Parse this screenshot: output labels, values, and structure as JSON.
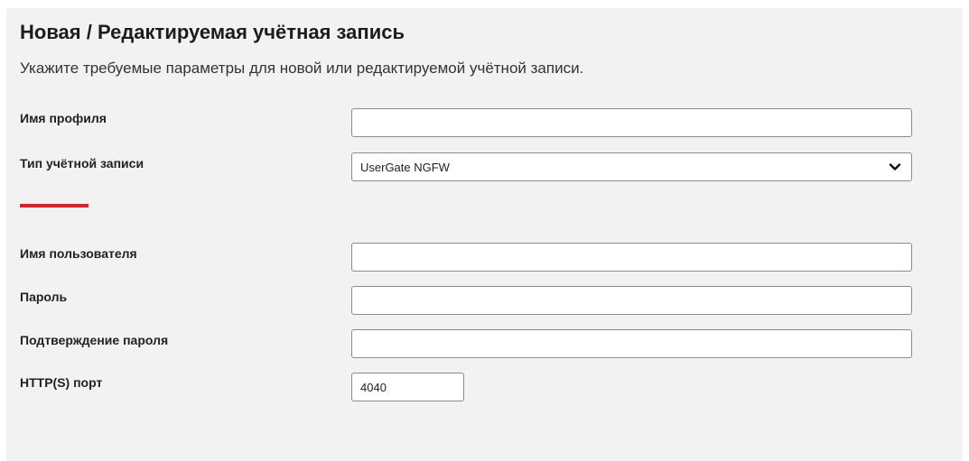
{
  "form": {
    "title": "Новая / Редактируемая учётная запись",
    "subtitle": "Укажите требуемые параметры для новой или редактируемой учётной записи.",
    "profile_name": {
      "label": "Имя профиля",
      "value": ""
    },
    "account_type": {
      "label": "Тип учётной записи",
      "selected": "UserGate NGFW"
    },
    "username": {
      "label": "Имя пользователя",
      "value": ""
    },
    "password": {
      "label": "Пароль",
      "value": ""
    },
    "password_confirm": {
      "label": "Подтверждение пароля",
      "value": ""
    },
    "http_port": {
      "label": "HTTP(S) порт",
      "value": "4040"
    }
  },
  "colors": {
    "accent_divider": "#e31e24",
    "panel_background": "#f2f2f3",
    "field_border": "#8c8c8c"
  },
  "icons": {
    "select_arrow": "chevron-down-icon"
  }
}
